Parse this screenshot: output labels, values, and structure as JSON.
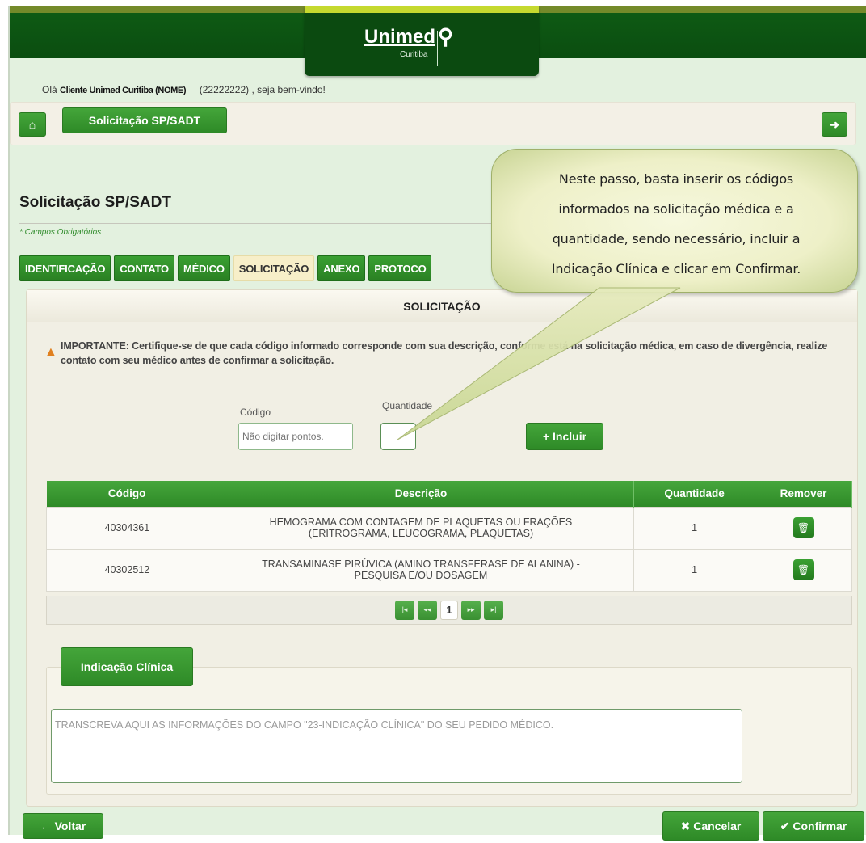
{
  "brand": {
    "name": "Unimed",
    "city": "Curitiba"
  },
  "greeting": {
    "prefix": "Olá",
    "user": "Cliente Unimed Curitiba (NOME)",
    "suffix": "(22222222) , seja bem-vindo!"
  },
  "nav": {
    "home_icon": "home-icon",
    "section_button": "Solicitação SP/SADT",
    "exit_icon": "exit-icon"
  },
  "page": {
    "title": "Solicitação SP/SADT",
    "required_note": "* Campos Obrigatórios"
  },
  "tabs": [
    {
      "label": "IDENTIFICAÇÃO",
      "active": false
    },
    {
      "label": "CONTATO",
      "active": false
    },
    {
      "label": "MÉDICO",
      "active": false
    },
    {
      "label": "SOLICITAÇÃO",
      "active": true
    },
    {
      "label": "ANEXO",
      "active": false
    },
    {
      "label": "PROTOCO",
      "active": false
    }
  ],
  "panel": {
    "heading": "SOLICITAÇÃO",
    "warning": "IMPORTANTE: Certifique-se de que cada código informado corresponde com sua descrição, conforme está na solicitação médica, em caso de divergência, realize contato com seu médico antes de confirmar a solicitação.",
    "code_label": "Código",
    "code_placeholder": "Não digitar pontos.",
    "qty_label": "Quantidade",
    "add_button": "Incluir"
  },
  "table": {
    "headers": [
      "Código",
      "Descrição",
      "Quantidade",
      "Remover"
    ],
    "rows": [
      {
        "code": "40304361",
        "description_line1": "HEMOGRAMA COM CONTAGEM DE PLAQUETAS OU FRAÇÕES",
        "description_line2": "(ERITROGRAMA, LEUCOGRAMA, PLAQUETAS)",
        "quantity": "1"
      },
      {
        "code": "40302512",
        "description_line1": "TRANSAMINASE PIRÚVICA (AMINO TRANSFERASE DE ALANINA) -",
        "description_line2": "PESQUISA E/OU DOSAGEM",
        "quantity": "1"
      }
    ],
    "current_page": "1"
  },
  "clinical": {
    "tab_label": "Indicação Clínica",
    "placeholder": "TRANSCREVA AQUI AS INFORMAÇÕES DO CAMPO \"23-INDICAÇÃO CLÍNICA\" DO SEU PEDIDO MÉDICO."
  },
  "footer": {
    "back": "Voltar",
    "cancel": "Cancelar",
    "confirm": "Confirmar"
  },
  "callout": {
    "line1": "Neste passo, basta inserir os códigos",
    "line2": "informados na solicitação médica e a",
    "line3": "quantidade, sendo necessário, incluir a",
    "line4": "Indicação Clínica e clicar em Confirmar."
  },
  "colors": {
    "brand_green": "#0b4a10",
    "button_green": "#2e8a27",
    "accent_lime": "#c5d92f",
    "active_tab": "#f7efc9",
    "warning_orange": "#e0801f"
  }
}
